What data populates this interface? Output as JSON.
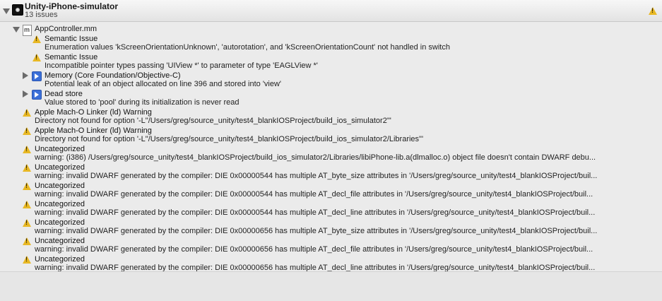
{
  "project": {
    "title": "Unity-iPhone-simulator",
    "subtitle": "13 issues"
  },
  "file": {
    "name": "AppController.mm",
    "issues": [
      {
        "title": "Semantic Issue",
        "detail": "Enumeration values 'kScreenOrientationUnknown', 'autorotation', and 'kScreenOrientationCount' not handled in switch",
        "icon": "warning-icon"
      },
      {
        "title": "Semantic Issue",
        "detail": "Incompatible pointer types passing 'UIView *' to parameter of type 'EAGLView *'",
        "icon": "warning-icon"
      },
      {
        "title": "Memory (Core Foundation/Objective-C)",
        "detail": "Potential leak of an object allocated on line 396 and stored into 'view'",
        "icon": "analyzer-icon"
      },
      {
        "title": "Dead store",
        "detail": "Value stored to 'pool' during its initialization is never read",
        "icon": "analyzer-icon"
      }
    ]
  },
  "issues": [
    {
      "title": "Apple Mach-O Linker (ld) Warning",
      "detail": "Directory not found for option '-L\"/Users/greg/source_unity/test4_blankIOSProject/build_ios_simulator2\"'"
    },
    {
      "title": "Apple Mach-O Linker (ld) Warning",
      "detail": "Directory not found for option '-L\"/Users/greg/source_unity/test4_blankIOSProject/build_ios_simulator2/Libraries\"'"
    },
    {
      "title": "Uncategorized",
      "detail": "warning: (i386) /Users/greg/source_unity/test4_blankIOSProject/build_ios_simulator2/Libraries/libiPhone-lib.a(dlmalloc.o) object file doesn't contain DWARF debu..."
    },
    {
      "title": "Uncategorized",
      "detail": "warning: invalid DWARF generated by the compiler: DIE 0x00000544 has multiple  AT_byte_size attributes in '/Users/greg/source_unity/test4_blankIOSProject/buil..."
    },
    {
      "title": "Uncategorized",
      "detail": "warning: invalid DWARF generated by the compiler: DIE 0x00000544 has multiple  AT_decl_file attributes in '/Users/greg/source_unity/test4_blankIOSProject/buil..."
    },
    {
      "title": "Uncategorized",
      "detail": "warning: invalid DWARF generated by the compiler: DIE 0x00000544 has multiple  AT_decl_line attributes in '/Users/greg/source_unity/test4_blankIOSProject/buil..."
    },
    {
      "title": "Uncategorized",
      "detail": "warning: invalid DWARF generated by the compiler: DIE 0x00000656 has multiple  AT_byte_size attributes in '/Users/greg/source_unity/test4_blankIOSProject/buil..."
    },
    {
      "title": "Uncategorized",
      "detail": "warning: invalid DWARF generated by the compiler: DIE 0x00000656 has multiple  AT_decl_file attributes in '/Users/greg/source_unity/test4_blankIOSProject/buil..."
    },
    {
      "title": "Uncategorized",
      "detail": "warning: invalid DWARF generated by the compiler: DIE 0x00000656 has multiple  AT_decl_line attributes in '/Users/greg/source_unity/test4_blankIOSProject/buil..."
    }
  ],
  "colors": {
    "warning": "#e8b824",
    "analyzer": "#3b6fd8",
    "background": "#ebebeb"
  }
}
